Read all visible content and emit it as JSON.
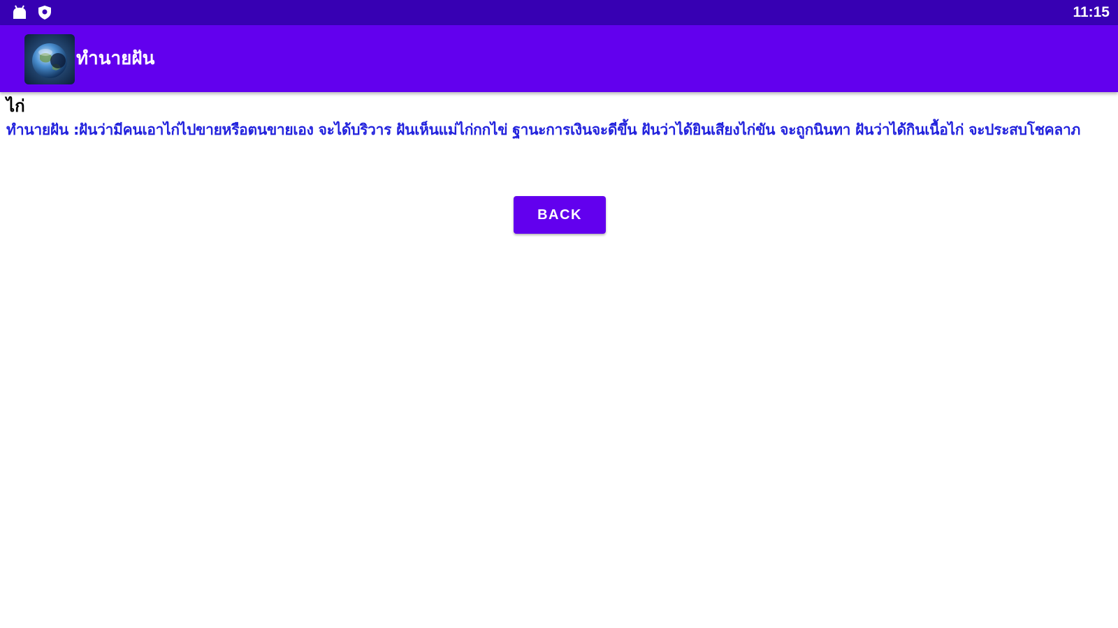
{
  "status_bar": {
    "time": "11:15",
    "icons": [
      "android-notification-icon",
      "shield-icon"
    ],
    "background": "#3700b3"
  },
  "app_bar": {
    "title": "ทำนายฝัน",
    "logo_icon": "earth-globe-icon",
    "background": "#6200ee"
  },
  "entry": {
    "title": "ไก่",
    "body": "ทำนายฝัน :ฝันว่ามีคนเอาไก่ไปขายหรือตนขายเอง จะได้บริวาร ฝันเห็นแม่ไก่กกไข่ ฐานะการเงินจะดีขึ้น ฝันว่าได้ยินเสียงไก่ขัน จะถูกนินทา ฝันว่าได้กินเนื้อไก่ จะประสบโชคลาภ",
    "body_color": "#2222dd"
  },
  "back_button": {
    "label": "BACK"
  }
}
